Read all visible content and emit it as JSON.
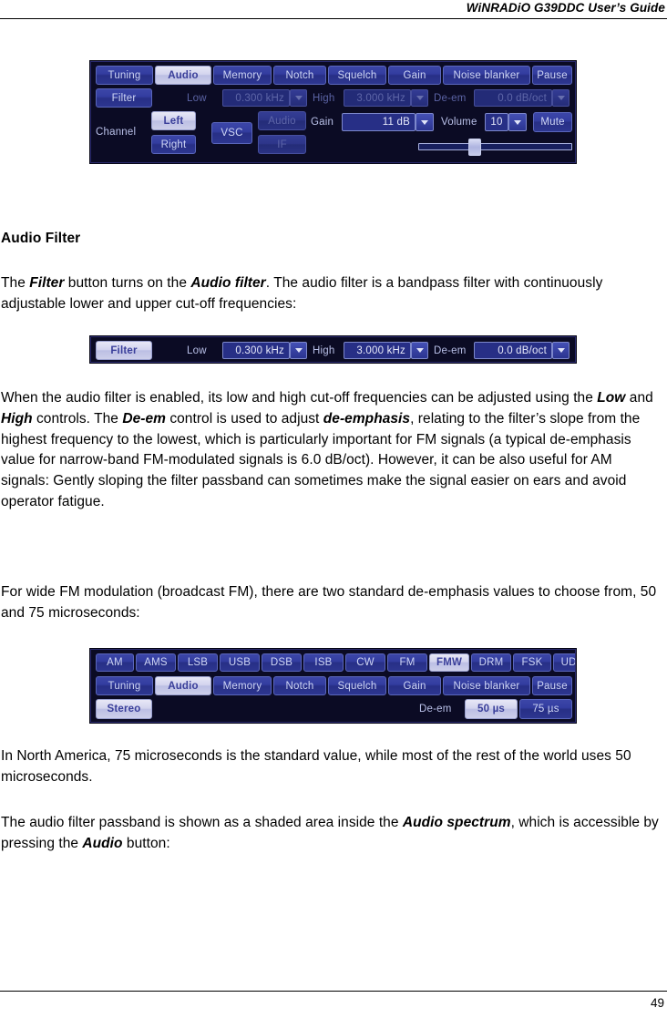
{
  "header": {
    "title": "WiNRADiO G39DDC User’s Guide"
  },
  "footer": {
    "page_number": "49"
  },
  "section": {
    "title": "Audio Filter"
  },
  "paragraphs": {
    "p1_a": "The ",
    "p1_b": "Filter",
    "p1_c": " button turns on the ",
    "p1_d": "Audio filter",
    "p1_e": ". The audio filter is a bandpass filter with continuously adjustable lower and upper cut-off frequencies:",
    "p2_a": "When the audio filter is enabled, its low and high cut-off frequencies can be adjusted using the ",
    "p2_b": "Low",
    "p2_c": " and ",
    "p2_d": "High",
    "p2_e": " controls. The ",
    "p2_f": "De-em",
    "p2_g": " control is used to adjust ",
    "p2_h": "de-emphasis",
    "p2_i": ", relating to the filter’s slope from the highest frequency to the lowest, which is particularly important for FM signals (a typical de-emphasis value for narrow-band FM-modulated signals is 6.0 dB/oct). However, it can be also useful for AM signals: Gently sloping the filter passband can sometimes make the signal easier on ears and avoid operator fatigue.",
    "p3": "For wide FM modulation (broadcast FM), there are two standard de-emphasis values to choose from, 50 and 75 microseconds:",
    "p4": "In North America, 75 microseconds is the standard value, while most of the rest of the world uses 50 microseconds.",
    "p5_a": "The audio filter passband is shown as a shaded area inside the ",
    "p5_b": "Audio spectrum",
    "p5_c": ", which is accessible by pressing the ",
    "p5_d": "Audio",
    "p5_e": " button:"
  },
  "colors": {
    "panel_background": "#0b0b24",
    "button_off": "#333da0",
    "button_on": "#d3d4ee",
    "button_disabled": "#2d358a",
    "label_text": "#b9c0e8",
    "field_text": "#e6e9fa"
  },
  "panel_audio": {
    "tabs": [
      {
        "label": "Tuning",
        "state": "off"
      },
      {
        "label": "Audio",
        "state": "on"
      },
      {
        "label": "Memory",
        "state": "off"
      },
      {
        "label": "Notch",
        "state": "off"
      },
      {
        "label": "Squelch",
        "state": "off"
      },
      {
        "label": "Gain",
        "state": "off"
      },
      {
        "label": "Noise blanker",
        "state": "off"
      },
      {
        "label": "Pause",
        "state": "off"
      }
    ],
    "filter_button": {
      "label": "Filter",
      "state": "off"
    },
    "low_label": "Low",
    "low_value": "0.300 kHz",
    "high_label": "High",
    "high_value": "3.000 kHz",
    "deem_label": "De-em",
    "deem_value": "0.0 dB/oct",
    "channel_label": "Channel",
    "channel_left": {
      "label": "Left",
      "state": "on"
    },
    "channel_right": {
      "label": "Right",
      "state": "off"
    },
    "vsc_button": {
      "label": "VSC",
      "state": "off"
    },
    "source_audio": {
      "label": "Audio",
      "state": "dis"
    },
    "source_if": {
      "label": "IF",
      "state": "dis"
    },
    "gain_label": "Gain",
    "gain_value": "11 dB",
    "volume_label": "Volume",
    "volume_value": "10",
    "mute_button": {
      "label": "Mute",
      "state": "off"
    }
  },
  "panel_filter": {
    "filter_button": {
      "label": "Filter",
      "state": "on"
    },
    "low_label": "Low",
    "low_value": "0.300 kHz",
    "high_label": "High",
    "high_value": "3.000 kHz",
    "deem_label": "De-em",
    "deem_value": "0.0 dB/oct"
  },
  "panel_modes": {
    "modes": [
      {
        "label": "AM",
        "state": "off"
      },
      {
        "label": "AMS",
        "state": "off"
      },
      {
        "label": "LSB",
        "state": "off"
      },
      {
        "label": "USB",
        "state": "off"
      },
      {
        "label": "DSB",
        "state": "off"
      },
      {
        "label": "ISB",
        "state": "off"
      },
      {
        "label": "CW",
        "state": "off"
      },
      {
        "label": "FM",
        "state": "off"
      },
      {
        "label": "FMW",
        "state": "on"
      },
      {
        "label": "DRM",
        "state": "off"
      },
      {
        "label": "FSK",
        "state": "off"
      },
      {
        "label": "UDM",
        "state": "off"
      }
    ],
    "tabs": [
      {
        "label": "Tuning",
        "state": "off"
      },
      {
        "label": "Audio",
        "state": "on"
      },
      {
        "label": "Memory",
        "state": "off"
      },
      {
        "label": "Notch",
        "state": "off"
      },
      {
        "label": "Squelch",
        "state": "off"
      },
      {
        "label": "Gain",
        "state": "off"
      },
      {
        "label": "Noise blanker",
        "state": "off"
      },
      {
        "label": "Pause",
        "state": "off"
      }
    ],
    "stereo_button": {
      "label": "Stereo",
      "state": "on"
    },
    "deem_label": "De-em",
    "deem_50": {
      "label": "50 µs",
      "state": "on"
    },
    "deem_75": {
      "label": "75 µs",
      "state": "off"
    }
  }
}
